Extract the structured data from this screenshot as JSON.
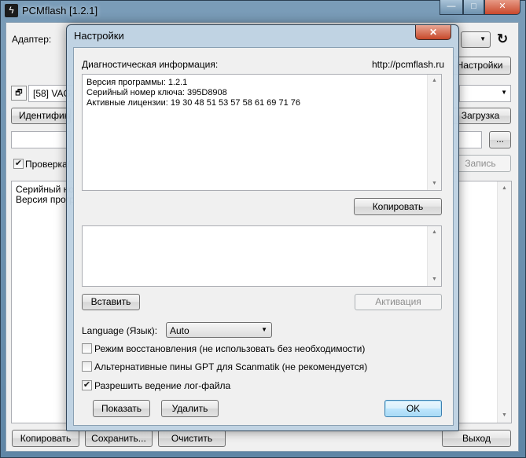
{
  "main_window": {
    "title": "PCMflash [1.2.1]",
    "adapter_label": "Адаптер:",
    "settings_button": "Настройки",
    "vehicle_combo_value": "[58] VAG",
    "identify_button": "Идентифика",
    "download_button": "Загрузка",
    "browse_button": "...",
    "verify_checkbox_label": "Проверка/",
    "verify_checked": true,
    "write_button": "Запись",
    "log_lines": [
      "Серийный но",
      "Версия прогр"
    ],
    "bottom_buttons": {
      "copy": "Копировать",
      "save": "Сохранить...",
      "clear": "Очистить",
      "exit": "Выход"
    },
    "window_controls": {
      "minimize": "—",
      "maximize": "□",
      "close": "✕"
    },
    "refresh_icon": "refresh-icon",
    "app_icon": "lightning-icon"
  },
  "dialog": {
    "title": "Настройки",
    "close_glyph": "✕",
    "diag_label": "Диагностическая информация:",
    "site_url": "http://pcmflash.ru",
    "diag_lines": [
      "Версия программы: 1.2.1",
      "Серийный номер ключа: 395D8908",
      "Активные лицензии: 19 30 48 51 53 57 58 61 69 71 76"
    ],
    "copy_button": "Копировать",
    "license_text": "",
    "paste_button": "Вставить",
    "activate_button": "Активация",
    "language_label": "Language (Язык):",
    "language_value": "Auto",
    "options": [
      {
        "label": "Режим восстановления (не использовать без необходимости)",
        "checked": false
      },
      {
        "label": "Альтернативные пины GPT для Scanmatik (не рекомендуется)",
        "checked": false
      },
      {
        "label": "Разрешить ведение лог-файла",
        "checked": true
      }
    ],
    "show_button": "Показать",
    "delete_button": "Удалить",
    "ok_button": "OK"
  }
}
